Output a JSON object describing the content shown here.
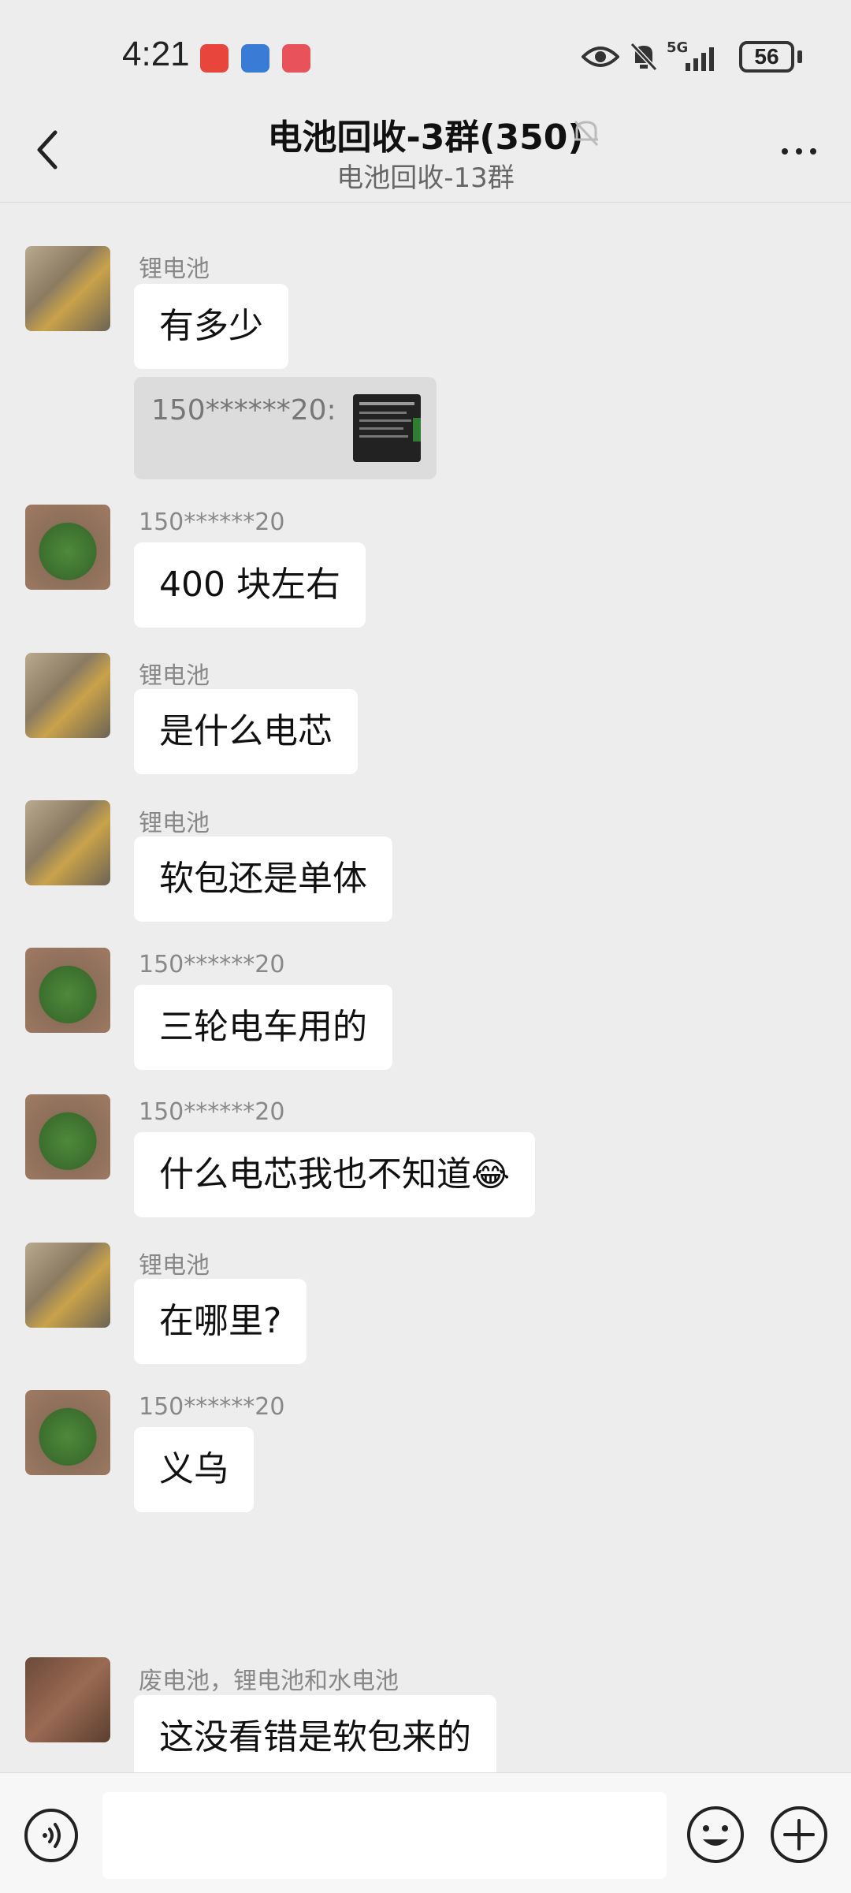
{
  "status_bar": {
    "time": "4:21",
    "battery": "56",
    "network": "5G"
  },
  "header": {
    "title": "电池回收-3群(350)",
    "subtitle": "电池回收-13群"
  },
  "messages": [
    {
      "sender": "锂电池",
      "text": "有多少",
      "avatar": "kid-avatar"
    },
    {
      "sender": "150******20",
      "text": "400 块左右",
      "avatar": "cartoon-avatar"
    },
    {
      "sender": "锂电池",
      "text": "是什么电芯",
      "avatar": "kid-avatar"
    },
    {
      "sender": "锂电池",
      "text": "软包还是单体",
      "avatar": "kid-avatar"
    },
    {
      "sender": "150******20",
      "text": "三轮电车用的",
      "avatar": "cartoon-avatar"
    },
    {
      "sender": "150******20",
      "text": "什么电芯我也不知道",
      "avatar": "cartoon-avatar"
    },
    {
      "sender": "锂电池",
      "text": "在哪里?",
      "avatar": "kid-avatar"
    },
    {
      "sender": "150******20",
      "text": "义乌",
      "avatar": "cartoon-avatar"
    },
    {
      "sender": "废电池，锂电池和水电池",
      "text": "这没看错是软包来的",
      "avatar": "photo-avatar"
    }
  ],
  "quote": {
    "text": "150******20:"
  },
  "emoji": "😂",
  "colors": {
    "background": "#ededed",
    "bubble": "#ffffff",
    "quote": "#dcdcdc"
  }
}
